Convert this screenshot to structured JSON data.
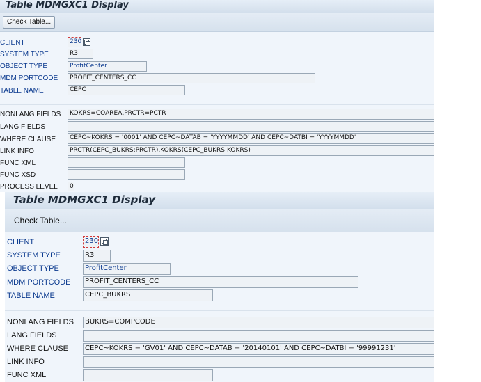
{
  "panels": [
    {
      "title": "Table MDMGXC1 Display",
      "check_table_label": "Check Table...",
      "labels": {
        "client": "CLIENT",
        "system_type": "SYSTEM TYPE",
        "object_type": "OBJECT TYPE",
        "mdm_portcode": "MDM PORTCODE",
        "table_name": "TABLE NAME",
        "nonlang_fields": "NONLANG FIELDS",
        "lang_fields": "LANG FIELDS",
        "where_clause": "WHERE CLAUSE",
        "link_info": "LINK INFO",
        "func_xml": "FUNC XML",
        "func_xsd": "FUNC XSD",
        "process_level": "PROCESS LEVEL"
      },
      "values": {
        "client": "230",
        "system_type": "R3",
        "object_type": "ProfitCenter",
        "mdm_portcode": "PROFIT_CENTERS_CC",
        "table_name": "CEPC",
        "nonlang_fields": "KOKRS=COAREA,PRCTR=PCTR",
        "lang_fields": "",
        "where_clause": "CEPC~KOKRS = '0001' AND CEPC~DATAB = 'YYYYMMDD' AND CEPC~DATBI = 'YYYYMMDD'",
        "link_info": "PRCTR(CEPC_BUKRS:PRCTR),KOKRS(CEPC_BUKRS:KOKRS)",
        "func_xml": "",
        "func_xsd": "",
        "process_level": "0"
      }
    },
    {
      "title": "Table MDMGXC1 Display",
      "check_table_label": "Check Table...",
      "labels": {
        "client": "CLIENT",
        "system_type": "SYSTEM TYPE",
        "object_type": "OBJECT TYPE",
        "mdm_portcode": "MDM PORTCODE",
        "table_name": "TABLE NAME",
        "nonlang_fields": "NONLANG FIELDS",
        "lang_fields": "LANG FIELDS",
        "where_clause": "WHERE CLAUSE",
        "link_info": "LINK INFO",
        "func_xml": "FUNC XML"
      },
      "values": {
        "client": "230",
        "system_type": "R3",
        "object_type": "ProfitCenter",
        "mdm_portcode": "PROFIT_CENTERS_CC",
        "table_name": "CEPC_BUKRS",
        "nonlang_fields": "BUKRS=COMPCODE",
        "lang_fields": "",
        "where_clause": "CEPC~KOKRS = 'GV01' AND CEPC~DATAB = '20140101' AND CEPC~DATBI = '99991231'",
        "link_info": "",
        "func_xml": ""
      }
    }
  ]
}
